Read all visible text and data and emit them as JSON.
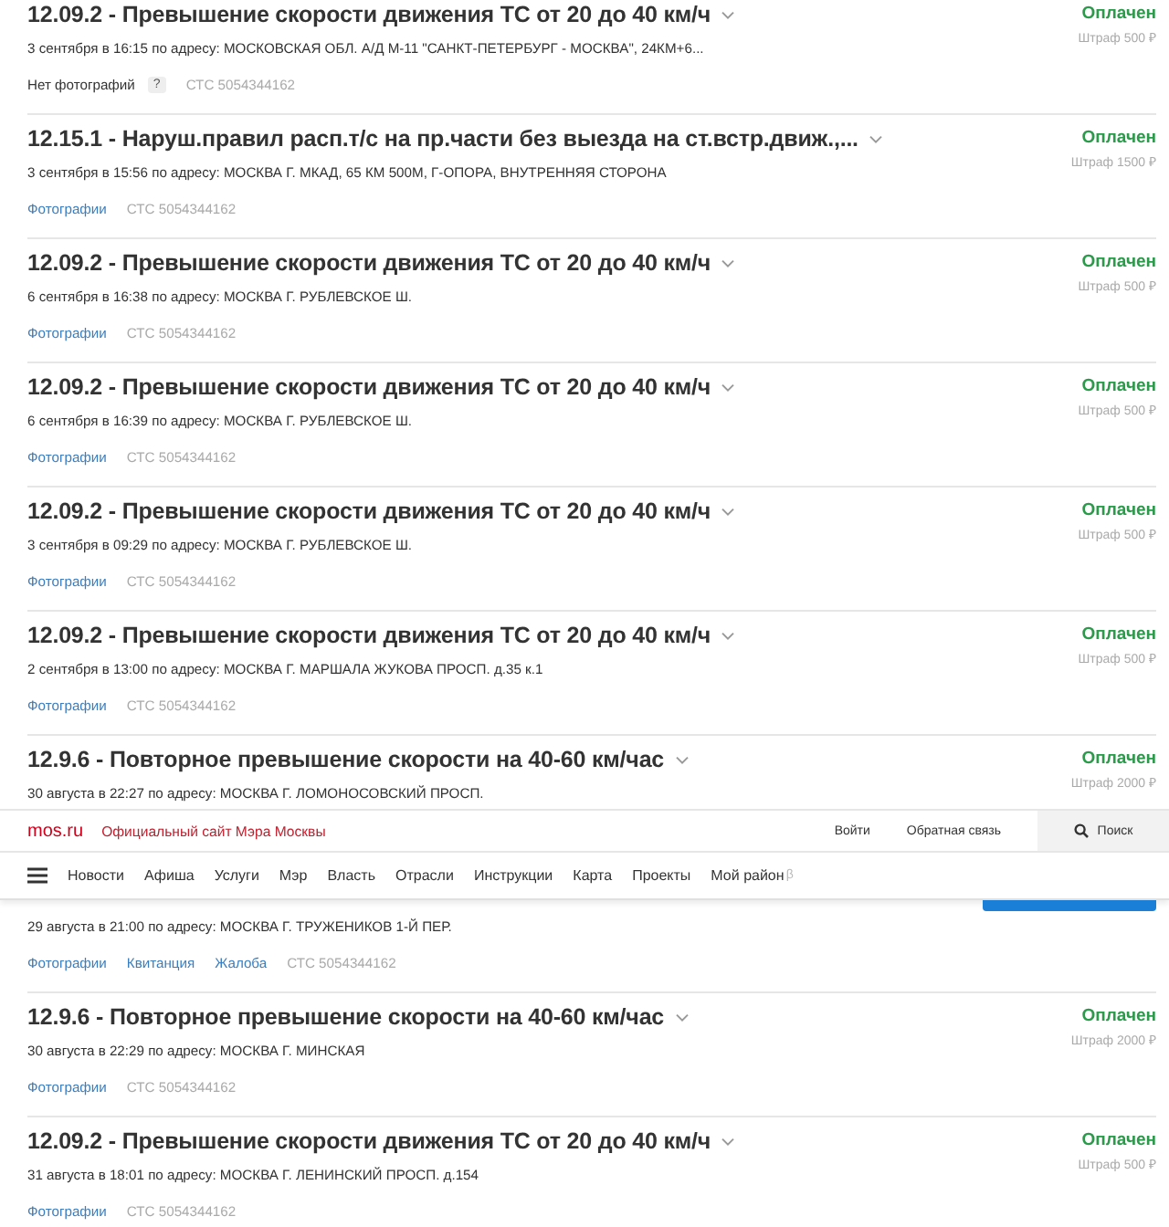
{
  "fines_above": [
    {
      "title": "12.09.2 - Превышение скорости движения ТС от 20 до 40 км/ч",
      "status": "Оплачен",
      "fine": "Штраф 500 ₽",
      "date": "3 сентября в 16:15 по адресу: МОСКОВСКАЯ ОБЛ. А/Д М-11 \"САНКТ-ПЕТЕРБУРГ - МОСКВА\", 24КМ+6...",
      "links": [
        {
          "kind": "text",
          "label": "Нет фотографий"
        },
        {
          "kind": "help",
          "label": "?"
        }
      ],
      "sts": "СТС 5054344162"
    },
    {
      "title": "12.15.1 - Наруш.правил расп.т/с на пр.части без выезда на ст.встр.движ.,...",
      "status": "Оплачен",
      "fine": "Штраф 1500 ₽",
      "date": "3 сентября в 15:56 по адресу: МОСКВА Г. МКАД, 65 КМ 500М, Г-ОПОРА, ВНУТРЕННЯЯ СТОРОНА",
      "links": [
        {
          "kind": "link",
          "label": "Фотографии"
        }
      ],
      "sts": "СТС 5054344162"
    },
    {
      "title": "12.09.2 - Превышение скорости движения ТС от 20 до 40 км/ч",
      "status": "Оплачен",
      "fine": "Штраф 500 ₽",
      "date": "6 сентября в 16:38 по адресу: МОСКВА Г. РУБЛЕВСКОЕ Ш.",
      "links": [
        {
          "kind": "link",
          "label": "Фотографии"
        }
      ],
      "sts": "СТС 5054344162"
    },
    {
      "title": "12.09.2 - Превышение скорости движения ТС от 20 до 40 км/ч",
      "status": "Оплачен",
      "fine": "Штраф 500 ₽",
      "date": "6 сентября в 16:39 по адресу: МОСКВА Г. РУБЛЕВСКОЕ Ш.",
      "links": [
        {
          "kind": "link",
          "label": "Фотографии"
        }
      ],
      "sts": "СТС 5054344162"
    },
    {
      "title": "12.09.2 - Превышение скорости движения ТС от 20 до 40 км/ч",
      "status": "Оплачен",
      "fine": "Штраф 500 ₽",
      "date": "3 сентября в 09:29 по адресу: МОСКВА Г. РУБЛЕВСКОЕ Ш.",
      "links": [
        {
          "kind": "link",
          "label": "Фотографии"
        }
      ],
      "sts": "СТС 5054344162"
    },
    {
      "title": "12.09.2 - Превышение скорости движения ТС от 20 до 40 км/ч",
      "status": "Оплачен",
      "fine": "Штраф 500 ₽",
      "date": "2 сентября в 13:00 по адресу: МОСКВА Г. МАРШАЛА ЖУКОВА ПРОСП. д.35 к.1",
      "links": [
        {
          "kind": "link",
          "label": "Фотографии"
        }
      ],
      "sts": "СТС 5054344162"
    },
    {
      "title": "12.9.6 - Повторное превышение скорости на 40-60 км/час",
      "status": "Оплачен",
      "fine": "Штраф 2000 ₽",
      "date": "30 августа в 22:27 по адресу: МОСКВА Г. ЛОМОНОСОВСКИЙ ПРОСП."
    }
  ],
  "site_header": {
    "logo": "mos.ru",
    "tagline": "Официальный сайт Мэра Москвы",
    "actions": [
      "Войти",
      "Обратная связь"
    ],
    "search": "Поиск",
    "nav": [
      "Новости",
      "Афиша",
      "Услуги",
      "Мэр",
      "Власть",
      "Отрасли",
      "Инструкции",
      "Карта",
      "Проекты",
      "Мой район"
    ],
    "nav_badge": "β"
  },
  "fines_below": [
    {
      "kind": "continued",
      "pay_button": true,
      "date": "29 августа в 21:00 по адресу: МОСКВА Г. ТРУЖЕНИКОВ 1-Й ПЕР.",
      "links": [
        {
          "kind": "link",
          "label": "Фотографии"
        },
        {
          "kind": "link",
          "label": "Квитанция"
        },
        {
          "kind": "link",
          "label": "Жалоба"
        }
      ],
      "sts": "СТС 5054344162"
    },
    {
      "kind": "full",
      "title": "12.9.6 - Повторное превышение скорости на 40-60 км/час",
      "status": "Оплачен",
      "fine": "Штраф 2000 ₽",
      "date": "30 августа в 22:29 по адресу: МОСКВА Г. МИНСКАЯ",
      "links": [
        {
          "kind": "link",
          "label": "Фотографии"
        }
      ],
      "sts": "СТС 5054344162"
    },
    {
      "kind": "full",
      "title": "12.09.2 - Превышение скорости движения ТС от 20 до 40 км/ч",
      "status": "Оплачен",
      "fine": "Штраф 500 ₽",
      "date": "31 августа в 18:01 по адресу: МОСКВА Г. ЛЕНИНСКИЙ ПРОСП. д.154",
      "links": [
        {
          "kind": "link",
          "label": "Фотографии"
        }
      ],
      "sts": "СТС 5054344162"
    }
  ]
}
